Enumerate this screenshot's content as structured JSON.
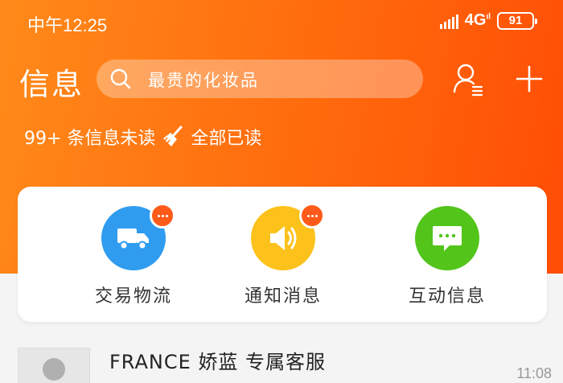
{
  "status_bar": {
    "time": "中午12:25",
    "network": "4G",
    "battery": "91"
  },
  "header": {
    "title": "信息",
    "search_placeholder": "最贵的化妆品",
    "unread_text": "99+ 条信息未读",
    "mark_all_read": "全部已读"
  },
  "categories": [
    {
      "label": "交易物流",
      "icon": "truck-icon",
      "color": "#2f9cf0",
      "has_badge": true
    },
    {
      "label": "通知消息",
      "icon": "speaker-icon",
      "color": "#fcc21b",
      "has_badge": true
    },
    {
      "label": "互动信息",
      "icon": "chat-bubble-icon",
      "color": "#52c41a",
      "has_badge": false
    }
  ],
  "messages": [
    {
      "title": "FRANCE 娇蓝 专属客服",
      "time": "11:08"
    }
  ],
  "colors": {
    "header_start": "#ff8a1a",
    "header_end": "#ff4d05",
    "badge": "#ff5a1a"
  }
}
